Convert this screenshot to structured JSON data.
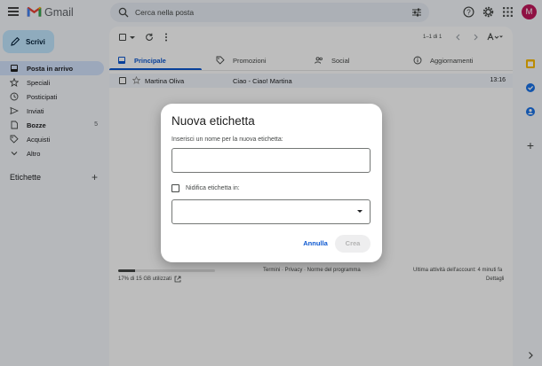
{
  "app": {
    "name": "Gmail",
    "avatar_letter": "M"
  },
  "search": {
    "placeholder": "Cerca nella posta"
  },
  "sidebar": {
    "compose_label": "Scrivi",
    "items": [
      {
        "label": "Posta in arrivo",
        "icon": "inbox-icon",
        "active": true,
        "count": ""
      },
      {
        "label": "Speciali",
        "icon": "star-icon",
        "active": false,
        "count": ""
      },
      {
        "label": "Posticipati",
        "icon": "clock-icon",
        "active": false,
        "count": ""
      },
      {
        "label": "Inviati",
        "icon": "send-icon",
        "active": false,
        "count": ""
      },
      {
        "label": "Bozze",
        "icon": "draft-icon",
        "active": false,
        "count": "5"
      },
      {
        "label": "Acquisti",
        "icon": "tag-icon",
        "active": false,
        "count": ""
      },
      {
        "label": "Altro",
        "icon": "chevron-down-icon",
        "active": false,
        "count": ""
      }
    ],
    "labels_heading": "Etichette"
  },
  "toolbar": {
    "pagination": "1–1 di 1"
  },
  "tabs": [
    {
      "label": "Principale",
      "icon": "inbox-icon",
      "active": true
    },
    {
      "label": "Promozioni",
      "icon": "tag-icon",
      "active": false
    },
    {
      "label": "Social",
      "icon": "people-icon",
      "active": false
    },
    {
      "label": "Aggiornamenti",
      "icon": "info-icon",
      "active": false
    }
  ],
  "email_rows": [
    {
      "sender": "Martina Oliva",
      "subject": "Ciao - Ciao! Martina",
      "time": "13:16"
    }
  ],
  "footer": {
    "storage_text": "17% di 15 GB utilizzati",
    "storage_fraction": 0.17,
    "links": "Termini · Privacy · Norme del programma",
    "activity_line1": "Ultima attività dell'account: 4 minuti fa",
    "activity_line2": "Dettagli"
  },
  "dialog": {
    "title": "Nuova etichetta",
    "prompt": "Inserisci un nome per la nuova etichetta:",
    "input_value": "",
    "nest_label": "Nidifica etichetta in:",
    "cancel_label": "Annulla",
    "create_label": "Crea"
  },
  "colors": {
    "accent": "#0b57d0",
    "compose_bg": "#c2e7ff",
    "active_nav_bg": "#d3e3fd",
    "avatar_bg": "#c2185b"
  }
}
